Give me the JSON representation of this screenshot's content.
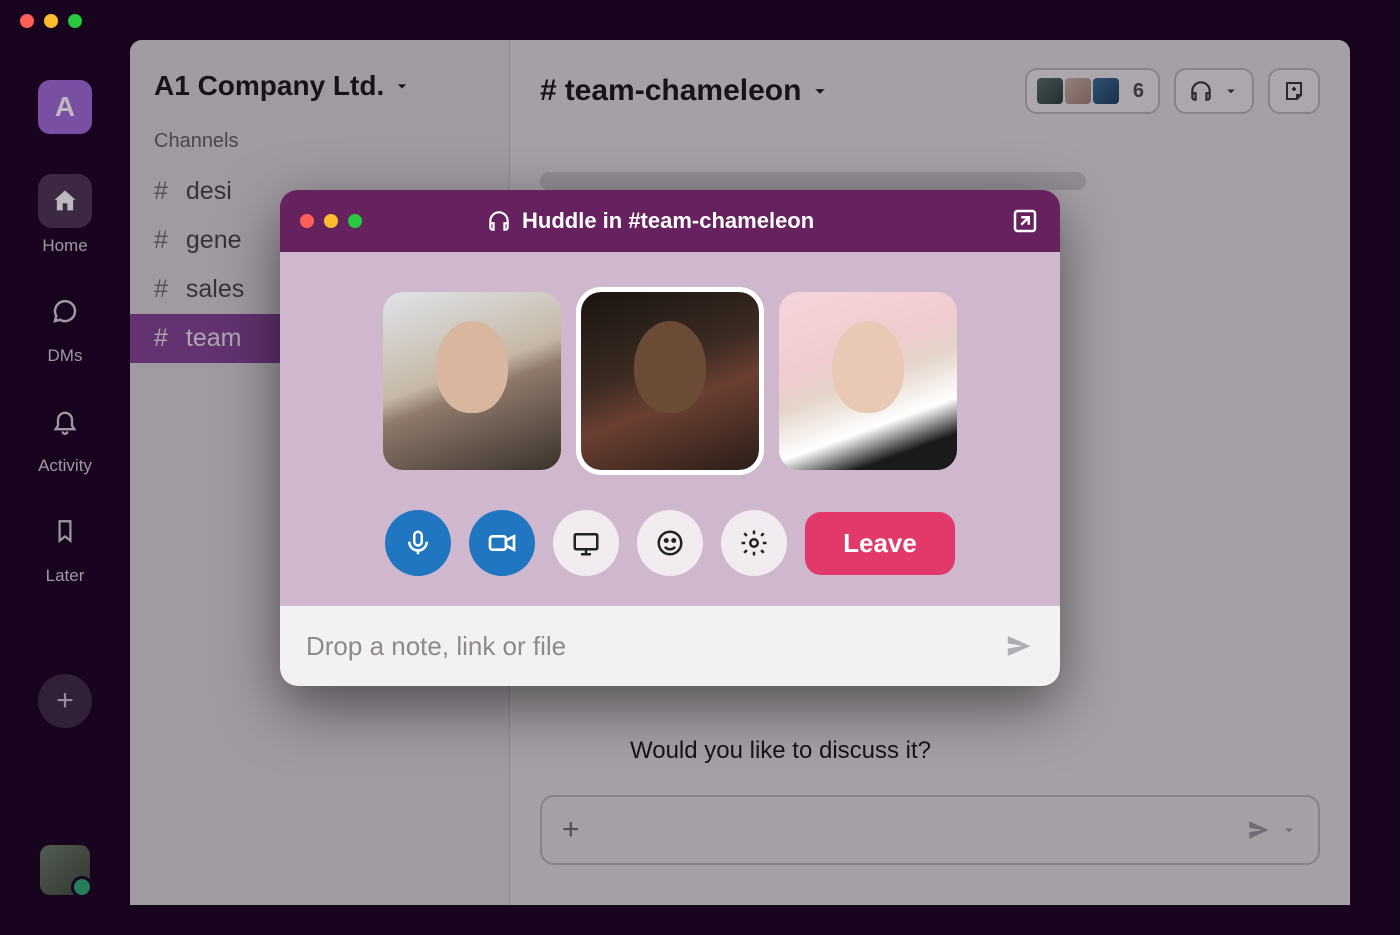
{
  "workspace": {
    "initial": "A",
    "name": "A1 Company Ltd."
  },
  "rail": {
    "home": "Home",
    "dms": "DMs",
    "activity": "Activity",
    "later": "Later"
  },
  "sidebar": {
    "section_channels": "Channels",
    "channels": [
      {
        "name": "desi"
      },
      {
        "name": "gene"
      },
      {
        "name": "sales"
      },
      {
        "name": "team"
      }
    ]
  },
  "channel_header": {
    "name": "team-chameleon",
    "member_count": "6"
  },
  "message": "Would you like to discuss it?",
  "huddle": {
    "title": "Huddle in #team-chameleon",
    "leave": "Leave",
    "note_placeholder": "Drop a note, link or file"
  }
}
